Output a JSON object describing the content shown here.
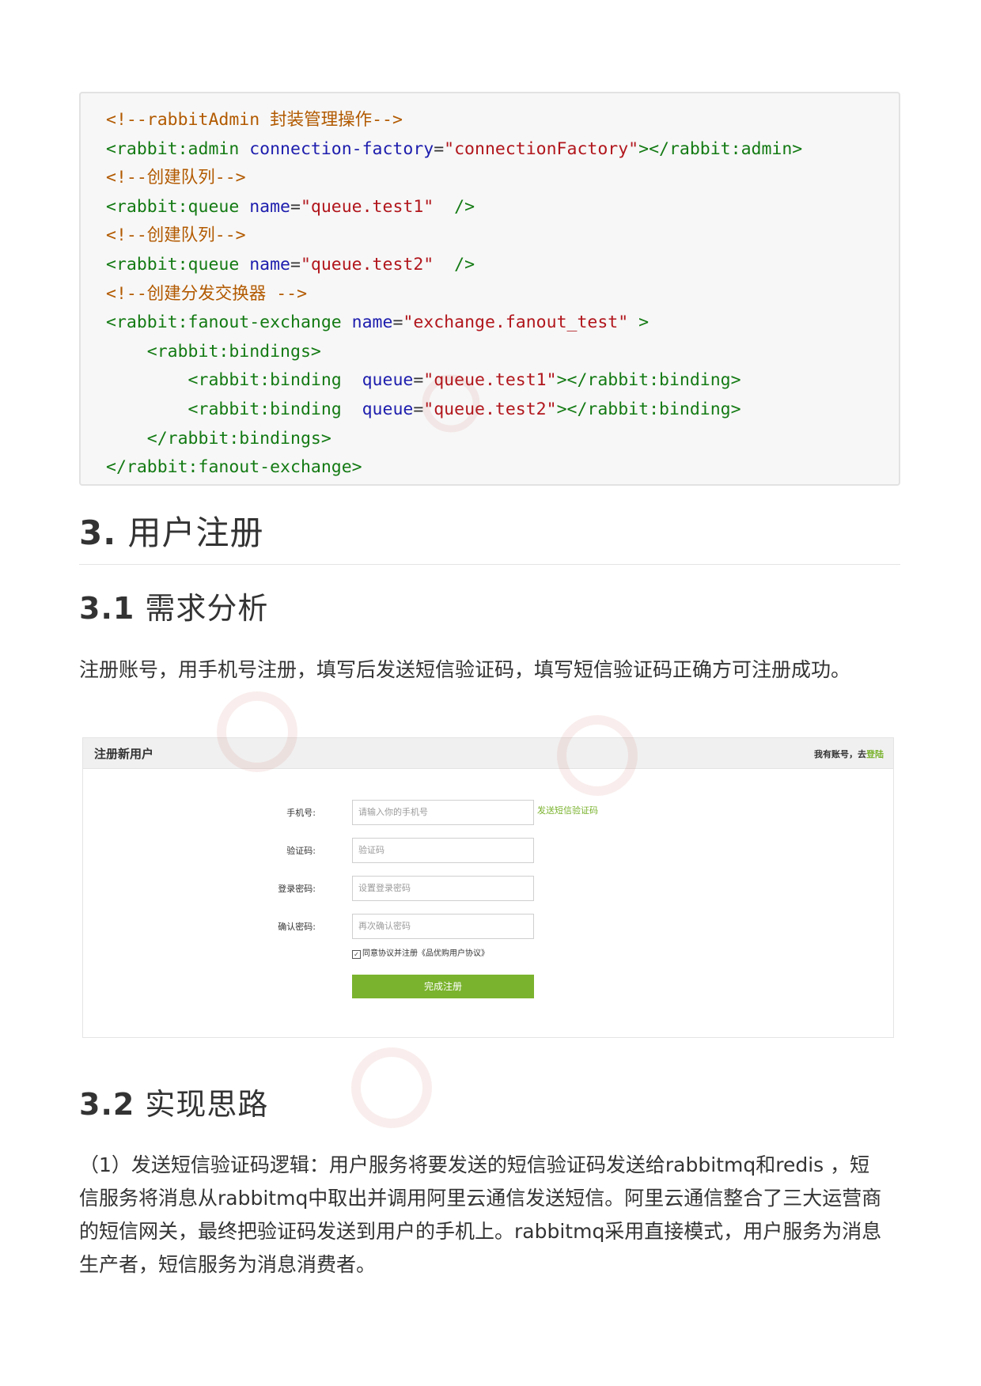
{
  "code_block": {
    "lines": [
      [
        {
          "t": "<!--rabbitAdmin 封装管理操作-->",
          "c": "comment"
        }
      ],
      [
        {
          "t": "<rabbit:admin ",
          "c": "tag"
        },
        {
          "t": "connection-factory",
          "c": "attr"
        },
        {
          "t": "=",
          "c": "eq"
        },
        {
          "t": "\"connectionFactory\"",
          "c": "str"
        },
        {
          "t": "></rabbit:admin>",
          "c": "tag"
        }
      ],
      [
        {
          "t": "<!--创建队列-->",
          "c": "comment"
        }
      ],
      [
        {
          "t": "<rabbit:queue ",
          "c": "tag"
        },
        {
          "t": "name",
          "c": "attr"
        },
        {
          "t": "=",
          "c": "eq"
        },
        {
          "t": "\"queue.test1\"",
          "c": "str"
        },
        {
          "t": "  />",
          "c": "tag"
        }
      ],
      [
        {
          "t": "<!--创建队列-->",
          "c": "comment"
        }
      ],
      [
        {
          "t": "<rabbit:queue ",
          "c": "tag"
        },
        {
          "t": "name",
          "c": "attr"
        },
        {
          "t": "=",
          "c": "eq"
        },
        {
          "t": "\"queue.test2\"",
          "c": "str"
        },
        {
          "t": "  />",
          "c": "tag"
        }
      ],
      [
        {
          "t": "<!--创建分发交换器 -->",
          "c": "comment"
        }
      ],
      [
        {
          "t": "<rabbit:fanout-exchange ",
          "c": "tag"
        },
        {
          "t": "name",
          "c": "attr"
        },
        {
          "t": "=",
          "c": "eq"
        },
        {
          "t": "\"exchange.fanout_test\"",
          "c": "str"
        },
        {
          "t": " >",
          "c": "tag"
        }
      ],
      [
        {
          "t": "    <rabbit:bindings>",
          "c": "tag"
        }
      ],
      [
        {
          "t": "        <rabbit:binding  ",
          "c": "tag"
        },
        {
          "t": "queue",
          "c": "attr"
        },
        {
          "t": "=",
          "c": "eq"
        },
        {
          "t": "\"queue.test1\"",
          "c": "str"
        },
        {
          "t": "></rabbit:binding>",
          "c": "tag"
        }
      ],
      [
        {
          "t": "        <rabbit:binding  ",
          "c": "tag"
        },
        {
          "t": "queue",
          "c": "attr"
        },
        {
          "t": "=",
          "c": "eq"
        },
        {
          "t": "\"queue.test2\"",
          "c": "str"
        },
        {
          "t": "></rabbit:binding>",
          "c": "tag"
        }
      ],
      [
        {
          "t": "    </rabbit:bindings>",
          "c": "tag"
        }
      ],
      [
        {
          "t": "</rabbit:fanout-exchange>",
          "c": "tag"
        }
      ]
    ]
  },
  "section3": {
    "number": "3.",
    "title": "用户注册"
  },
  "section3_1": {
    "number": "3.1",
    "title": "需求分析",
    "paragraph": "注册账号，用手机号注册，填写后发送短信验证码，填写短信验证码正确方可注册成功。"
  },
  "register_form": {
    "title": "注册新用户",
    "have_account": "我有账号，去",
    "login_link": "登陆",
    "phone_label": "手机号:",
    "phone_placeholder": "请输入你的手机号",
    "send_sms": "发送短信验证码",
    "code_label": "验证码:",
    "code_placeholder": "验证码",
    "password_label": "登录密码:",
    "password_placeholder": "设置登录密码",
    "confirm_label": "确认密码:",
    "confirm_placeholder": "再次确认密码",
    "agree_text": "同意协议并注册《品优购用户协议》",
    "agree_checked": true,
    "submit": "完成注册",
    "accent_color": "#7ab32e"
  },
  "section3_2": {
    "number": "3.2",
    "title": "实现思路",
    "paragraph": "（1）发送短信验证码逻辑：用户服务将要发送的短信验证码发送给rabbitmq和redis ，短信服务将消息从rabbitmq中取出并调用阿里云通信发送短信。阿里云通信整合了三大运营商的短信网关，最终把验证码发送到用户的手机上。rabbitmq采用直接模式，用户服务为消息生产者，短信服务为消息消费者。"
  },
  "colors": {
    "code_background": "#f7f7f7",
    "comment": "#b25a00",
    "tag": "#137a13",
    "attribute": "#1d1dae",
    "string": "#b1161c"
  }
}
